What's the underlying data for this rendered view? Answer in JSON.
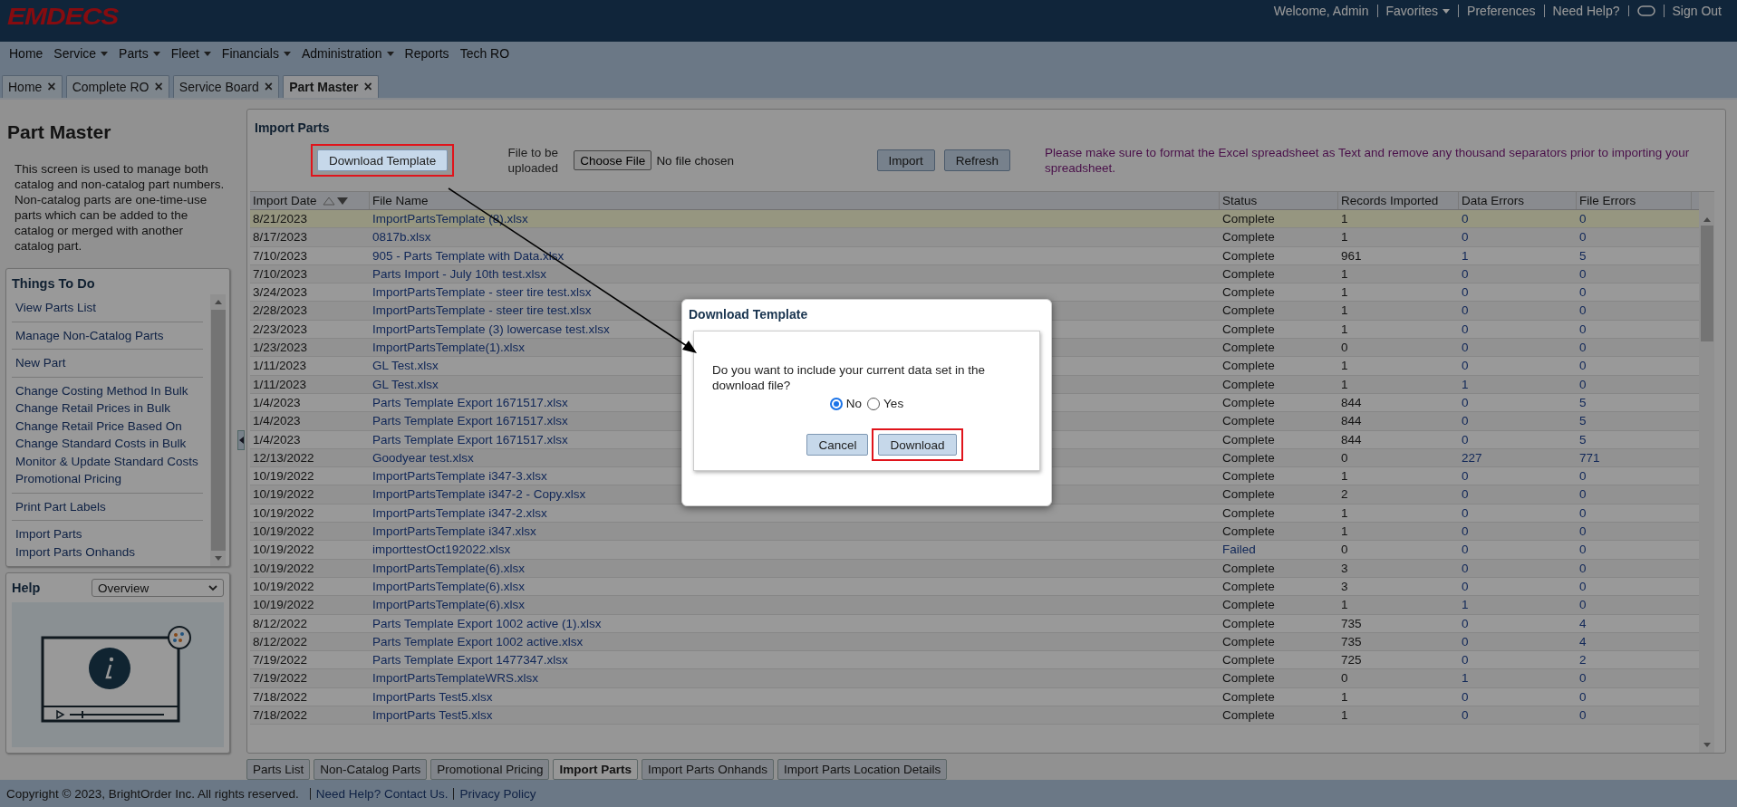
{
  "header": {
    "logo": "EMDECS",
    "links": [
      {
        "kind": "text",
        "label": "Welcome, Admin"
      },
      {
        "kind": "dropdown",
        "label": "Favorites"
      },
      {
        "kind": "link",
        "label": "Preferences"
      },
      {
        "kind": "link",
        "label": "Need Help?"
      },
      {
        "kind": "toggle"
      },
      {
        "kind": "link",
        "label": "Sign Out"
      }
    ]
  },
  "menu": [
    {
      "label": "Home",
      "dropdown": false
    },
    {
      "label": "Service",
      "dropdown": true
    },
    {
      "label": "Parts",
      "dropdown": true
    },
    {
      "label": "Fleet",
      "dropdown": true
    },
    {
      "label": "Financials",
      "dropdown": true
    },
    {
      "label": "Administration",
      "dropdown": true
    },
    {
      "label": "Reports",
      "dropdown": false
    },
    {
      "label": "Tech RO",
      "dropdown": false
    }
  ],
  "tabs": [
    {
      "label": "Home",
      "close": "×",
      "selected": false
    },
    {
      "label": "Complete RO",
      "close": "×",
      "selected": false
    },
    {
      "label": "Service Board",
      "close": "×",
      "selected": false
    },
    {
      "label": "Part Master",
      "close": "×",
      "selected": true
    }
  ],
  "sidebar": {
    "title": "Part Master",
    "description": "This screen is used to manage both catalog and non-catalog part numbers. Non-catalog parts are one-time-use parts which can be added to the catalog or merged with another catalog part.",
    "things_to_do": {
      "title": "Things To Do",
      "groups": [
        [
          "View Parts List"
        ],
        [
          "Manage Non-Catalog Parts"
        ],
        [
          "New Part"
        ],
        [
          "Change Costing Method In Bulk",
          "Change Retail Prices in Bulk",
          "Change Retail Price Based On",
          "Change Standard Costs in Bulk",
          "Monitor & Update Standard Costs",
          "Promotional Pricing"
        ],
        [
          "Print Part Labels"
        ],
        [
          "Import Parts",
          "Import Parts Onhands"
        ]
      ]
    },
    "help": {
      "title": "Help",
      "select": "Overview"
    }
  },
  "import_parts": {
    "title": "Import Parts",
    "download_button": "Download Template",
    "file_label": "File to be uploaded",
    "choose_file": "Choose File",
    "no_file": "No file chosen",
    "import_button": "Import",
    "refresh_button": "Refresh",
    "notice": "Please make sure to format the Excel spreadsheet as Text and remove any thousand separators prior to importing your spreadsheet."
  },
  "table": {
    "columns": [
      "Import Date",
      "File Name",
      "Status",
      "Records Imported",
      "Data Errors",
      "File Errors"
    ],
    "rows": [
      {
        "date": "8/21/2023",
        "file": "ImportPartsTemplate (8).xlsx",
        "status": "Complete",
        "failed": false,
        "records": "1",
        "data_errors": "0",
        "file_errors": "0",
        "selected": true
      },
      {
        "date": "8/17/2023",
        "file": "0817b.xlsx",
        "status": "Complete",
        "failed": false,
        "records": "1",
        "data_errors": "0",
        "file_errors": "0",
        "selected": false
      },
      {
        "date": "7/10/2023",
        "file": "905 - Parts Template with Data.xlsx",
        "status": "Complete",
        "failed": false,
        "records": "961",
        "data_errors": "1",
        "file_errors": "5",
        "selected": false
      },
      {
        "date": "7/10/2023",
        "file": "Parts Import - July 10th test.xlsx",
        "status": "Complete",
        "failed": false,
        "records": "1",
        "data_errors": "0",
        "file_errors": "0",
        "selected": false
      },
      {
        "date": "3/24/2023",
        "file": "ImportPartsTemplate - steer tire test.xlsx",
        "status": "Complete",
        "failed": false,
        "records": "1",
        "data_errors": "0",
        "file_errors": "0",
        "selected": false
      },
      {
        "date": "2/28/2023",
        "file": "ImportPartsTemplate - steer tire test.xlsx",
        "status": "Complete",
        "failed": false,
        "records": "1",
        "data_errors": "0",
        "file_errors": "0",
        "selected": false
      },
      {
        "date": "2/23/2023",
        "file": "ImportPartsTemplate (3) lowercase test.xlsx",
        "status": "Complete",
        "failed": false,
        "records": "1",
        "data_errors": "0",
        "file_errors": "0",
        "selected": false
      },
      {
        "date": "1/23/2023",
        "file": "ImportPartsTemplate(1).xlsx",
        "status": "Complete",
        "failed": false,
        "records": "0",
        "data_errors": "0",
        "file_errors": "0",
        "selected": false
      },
      {
        "date": "1/11/2023",
        "file": "GL Test.xlsx",
        "status": "Complete",
        "failed": false,
        "records": "1",
        "data_errors": "0",
        "file_errors": "0",
        "selected": false
      },
      {
        "date": "1/11/2023",
        "file": "GL Test.xlsx",
        "status": "Complete",
        "failed": false,
        "records": "1",
        "data_errors": "1",
        "file_errors": "0",
        "selected": false
      },
      {
        "date": "1/4/2023",
        "file": "Parts Template Export 1671517.xlsx",
        "status": "Complete",
        "failed": false,
        "records": "844",
        "data_errors": "0",
        "file_errors": "5",
        "selected": false
      },
      {
        "date": "1/4/2023",
        "file": "Parts Template Export 1671517.xlsx",
        "status": "Complete",
        "failed": false,
        "records": "844",
        "data_errors": "0",
        "file_errors": "5",
        "selected": false
      },
      {
        "date": "1/4/2023",
        "file": "Parts Template Export 1671517.xlsx",
        "status": "Complete",
        "failed": false,
        "records": "844",
        "data_errors": "0",
        "file_errors": "5",
        "selected": false
      },
      {
        "date": "12/13/2022",
        "file": "Goodyear test.xlsx",
        "status": "Complete",
        "failed": false,
        "records": "0",
        "data_errors": "227",
        "file_errors": "771",
        "selected": false
      },
      {
        "date": "10/19/2022",
        "file": "ImportPartsTemplate i347-3.xlsx",
        "status": "Complete",
        "failed": false,
        "records": "1",
        "data_errors": "0",
        "file_errors": "0",
        "selected": false
      },
      {
        "date": "10/19/2022",
        "file": "ImportPartsTemplate i347-2 - Copy.xlsx",
        "status": "Complete",
        "failed": false,
        "records": "2",
        "data_errors": "0",
        "file_errors": "0",
        "selected": false
      },
      {
        "date": "10/19/2022",
        "file": "ImportPartsTemplate i347-2.xlsx",
        "status": "Complete",
        "failed": false,
        "records": "1",
        "data_errors": "0",
        "file_errors": "0",
        "selected": false
      },
      {
        "date": "10/19/2022",
        "file": "ImportPartsTemplate i347.xlsx",
        "status": "Complete",
        "failed": false,
        "records": "1",
        "data_errors": "0",
        "file_errors": "0",
        "selected": false
      },
      {
        "date": "10/19/2022",
        "file": "importtestOct192022.xlsx",
        "status": "Failed",
        "failed": true,
        "records": "0",
        "data_errors": "0",
        "file_errors": "0",
        "selected": false
      },
      {
        "date": "10/19/2022",
        "file": "ImportPartsTemplate(6).xlsx",
        "status": "Complete",
        "failed": false,
        "records": "3",
        "data_errors": "0",
        "file_errors": "0",
        "selected": false
      },
      {
        "date": "10/19/2022",
        "file": "ImportPartsTemplate(6).xlsx",
        "status": "Complete",
        "failed": false,
        "records": "3",
        "data_errors": "0",
        "file_errors": "0",
        "selected": false
      },
      {
        "date": "10/19/2022",
        "file": "ImportPartsTemplate(6).xlsx",
        "status": "Complete",
        "failed": false,
        "records": "1",
        "data_errors": "1",
        "file_errors": "0",
        "selected": false
      },
      {
        "date": "8/12/2022",
        "file": "Parts Template Export 1002 active (1).xlsx",
        "status": "Complete",
        "failed": false,
        "records": "735",
        "data_errors": "0",
        "file_errors": "4",
        "selected": false
      },
      {
        "date": "8/12/2022",
        "file": "Parts Template Export 1002 active.xlsx",
        "status": "Complete",
        "failed": false,
        "records": "735",
        "data_errors": "0",
        "file_errors": "4",
        "selected": false
      },
      {
        "date": "7/19/2022",
        "file": "Parts Template Export 1477347.xlsx",
        "status": "Complete",
        "failed": false,
        "records": "725",
        "data_errors": "0",
        "file_errors": "2",
        "selected": false
      },
      {
        "date": "7/19/2022",
        "file": "ImportPartsTemplateWRS.xlsx",
        "status": "Complete",
        "failed": false,
        "records": "0",
        "data_errors": "1",
        "file_errors": "0",
        "selected": false
      },
      {
        "date": "7/18/2022",
        "file": "ImportParts Test5.xlsx",
        "status": "Complete",
        "failed": false,
        "records": "1",
        "data_errors": "0",
        "file_errors": "0",
        "selected": false
      },
      {
        "date": "7/18/2022",
        "file": "ImportParts Test5.xlsx",
        "status": "Complete",
        "failed": false,
        "records": "1",
        "data_errors": "0",
        "file_errors": "0",
        "selected": false
      }
    ]
  },
  "bottom_tabs": [
    {
      "label": "Parts List",
      "selected": false
    },
    {
      "label": "Non-Catalog Parts",
      "selected": false
    },
    {
      "label": "Promotional Pricing",
      "selected": false
    },
    {
      "label": "Import Parts",
      "selected": true
    },
    {
      "label": "Import Parts Onhands",
      "selected": false
    },
    {
      "label": "Import Parts Location Details",
      "selected": false
    }
  ],
  "footer": {
    "copyright": "Copyright © 2023, BrightOrder Inc. All rights reserved.",
    "links": [
      "Need Help? Contact Us.",
      "Privacy Policy"
    ]
  },
  "dialog": {
    "title": "Download Template",
    "question": "Do you want to include your current data set in the download file?",
    "options": [
      {
        "label": "No",
        "selected": true
      },
      {
        "label": "Yes",
        "selected": false
      }
    ],
    "cancel_button": "Cancel",
    "download_button": "Download"
  }
}
